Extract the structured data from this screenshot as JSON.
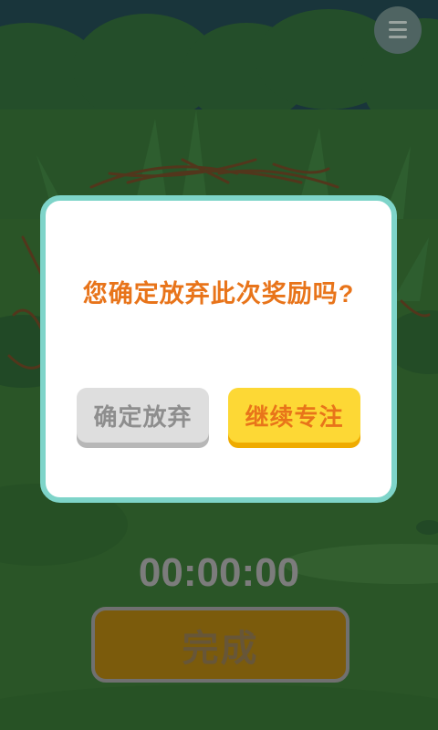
{
  "menu": {
    "icon": "hamburger-menu-icon"
  },
  "dialog": {
    "question": "您确定放弃此次奖励吗?",
    "confirm_label": "确定放弃",
    "continue_label": "继续专注"
  },
  "timer": {
    "value": "00:00:00"
  },
  "finish_button": {
    "label": "完成"
  },
  "colors": {
    "accent_orange": "#e8741a",
    "dialog_border": "#7ed4c9",
    "continue_yellow": "#fdd835",
    "confirm_gray": "#dedede"
  }
}
